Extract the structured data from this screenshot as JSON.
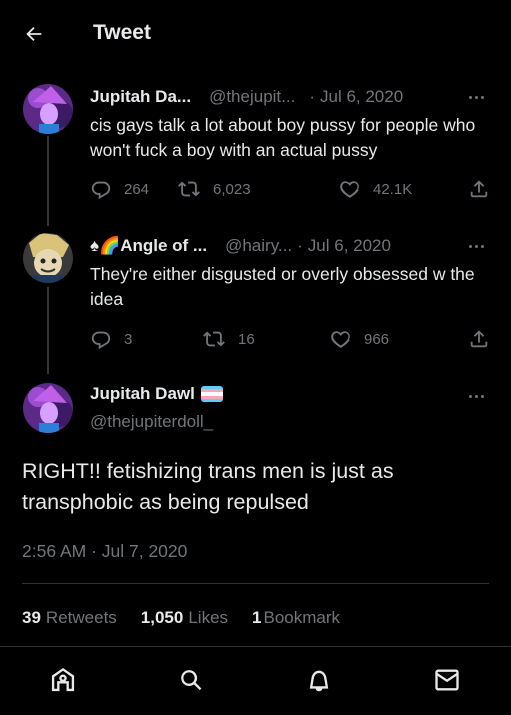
{
  "header": {
    "title": "Tweet"
  },
  "thread": [
    {
      "name": "Jupitah Da...",
      "handle": "@thejupit...",
      "separator": "·",
      "date": "Jul 6, 2020",
      "text": "cis gays talk a lot about boy pussy for people who won't fuck a boy with an actual pussy",
      "replies": "264",
      "retweets": "6,023",
      "likes": "42.1K"
    },
    {
      "name_prefix": "♠🌈",
      "name": "Angle of ...",
      "handle": "@hairy...",
      "separator": "·",
      "date": "Jul 6, 2020",
      "text": "They're either disgusted or overly obsessed w the idea",
      "replies": "3",
      "retweets": "16",
      "likes": "966"
    }
  ],
  "main_tweet": {
    "name": "Jupitah Dawl",
    "handle": "@thejupiterdoll_",
    "text": "RIGHT!! fetishizing trans men is just as transphobic as being repulsed",
    "timestamp": "2:56 AM · Jul 7, 2020",
    "stats": {
      "retweets_count": "39",
      "retweets_label": "Retweets",
      "likes_count": "1,050",
      "likes_label": "Likes",
      "bookmarks_count": "1",
      "bookmarks_label": "Bookmark"
    }
  },
  "nav": {
    "items": [
      "home-icon",
      "search-icon",
      "notifications-icon",
      "messages-icon"
    ]
  },
  "colors": {
    "background": "#000000",
    "text": "#e7e9ea",
    "muted": "#71767b",
    "divider": "#2f3336",
    "flag_blue": "#5bcefa",
    "flag_pink": "#f5a9b8",
    "flag_white": "#ffffff"
  }
}
